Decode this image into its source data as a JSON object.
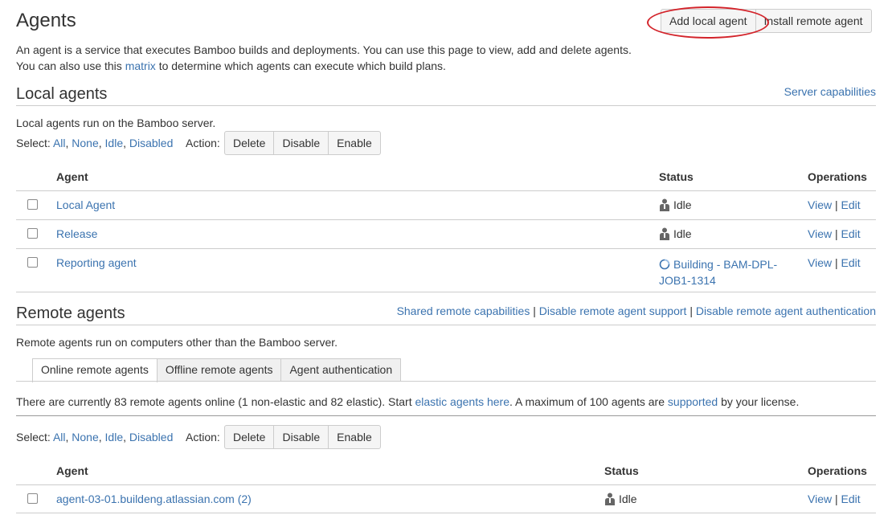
{
  "page": {
    "title": "Agents",
    "add_local_agent": "Add local agent",
    "install_remote_agent": "Install remote agent",
    "intro_line1": "An agent is a service that executes Bamboo builds and deployments. You can use this page to view, add and delete agents.",
    "intro_line2_pre": "You can also use this ",
    "intro_line2_link": "matrix",
    "intro_line2_post": " to determine which agents can execute which build plans."
  },
  "local": {
    "heading": "Local agents",
    "server_capabilities": "Server capabilities",
    "description": "Local agents run on the Bamboo server.",
    "select_label": "Select:",
    "select_all": "All",
    "select_none": "None",
    "select_idle": "Idle",
    "select_disabled": "Disabled",
    "action_label": "Action:",
    "delete": "Delete",
    "disable": "Disable",
    "enable": "Enable",
    "col_agent": "Agent",
    "col_status": "Status",
    "col_operations": "Operations",
    "rows": [
      {
        "name": "Local Agent",
        "status": "Idle"
      },
      {
        "name": "Release",
        "status": "Idle"
      },
      {
        "name": "Reporting agent",
        "status_line1": "Building - BAM-DPL-",
        "status_line2": "JOB1-1314"
      }
    ],
    "view": "View",
    "sep": "|",
    "edit": "Edit"
  },
  "remote": {
    "heading": "Remote agents",
    "shared_capabilities": "Shared remote capabilities",
    "disable_support": "Disable remote agent support",
    "disable_auth": "Disable remote agent authentication",
    "sep": "|",
    "description": "Remote agents run on computers other than the Bamboo server.",
    "tabs": [
      "Online remote agents",
      "Offline remote agents",
      "Agent authentication"
    ],
    "online_pre": "There are currently 83 remote agents online (1 non-elastic and 82 elastic). Start ",
    "online_link1": "elastic agents here",
    "online_mid": ". A maximum of 100 agents are ",
    "online_link2": "supported",
    "online_post": " by your license.",
    "select_label": "Select:",
    "select_all": "All",
    "select_none": "None",
    "select_idle": "Idle",
    "select_disabled": "Disabled",
    "action_label": "Action:",
    "delete": "Delete",
    "disable": "Disable",
    "enable": "Enable",
    "col_agent": "Agent",
    "col_status": "Status",
    "col_operations": "Operations",
    "rows": [
      {
        "name": "agent-03-01.buildeng.atlassian.com (2)",
        "status": "Idle"
      }
    ],
    "view": "View",
    "edit": "Edit"
  },
  "colors": {
    "link": "#3b73af",
    "annotation": "#d3242b"
  }
}
